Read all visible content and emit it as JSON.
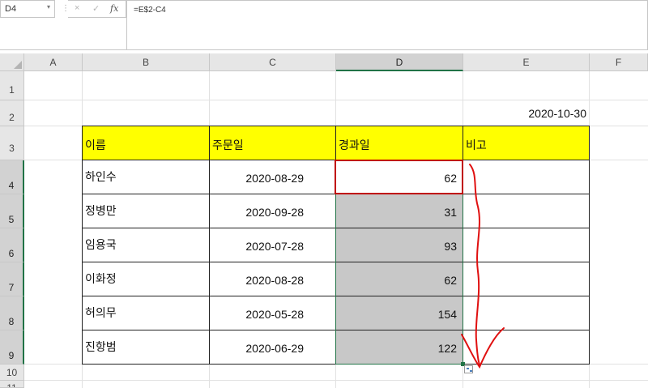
{
  "formula_bar": {
    "name_box": "D4",
    "formula": "=E$2-C4",
    "icons": [
      "cancel-icon",
      "enter-icon",
      "function-icon"
    ],
    "fx_label": "fx",
    "cancel_glyph": "×",
    "enter_glyph": "✓"
  },
  "columns": [
    "A",
    "B",
    "C",
    "D",
    "E",
    "F"
  ],
  "selected_column": "D",
  "rows": [
    "1",
    "2",
    "3",
    "4",
    "5",
    "6",
    "7",
    "8",
    "9",
    "10",
    "11"
  ],
  "selected_rows": [
    "4",
    "5",
    "6",
    "7",
    "8",
    "9"
  ],
  "reference_date": "2020-10-30",
  "table": {
    "headers": [
      "이름",
      "주문일",
      "경과일",
      "비고"
    ],
    "rows": [
      {
        "name": "하인수",
        "order_date": "2020-08-29",
        "days": "62",
        "note": ""
      },
      {
        "name": "정병만",
        "order_date": "2020-09-28",
        "days": "31",
        "note": ""
      },
      {
        "name": "임용국",
        "order_date": "2020-07-28",
        "days": "93",
        "note": ""
      },
      {
        "name": "이화정",
        "order_date": "2020-08-28",
        "days": "62",
        "note": ""
      },
      {
        "name": "허의무",
        "order_date": "2020-05-28",
        "days": "154",
        "note": ""
      },
      {
        "name": "진항범",
        "order_date": "2020-06-29",
        "days": "122",
        "note": ""
      }
    ]
  },
  "colors": {
    "header_fill": "#ffff00",
    "selection_fill": "#c8c8c8",
    "active_cell_border": "#c00000",
    "selection_accent": "#217346",
    "annotation_arrow": "#e01010"
  }
}
